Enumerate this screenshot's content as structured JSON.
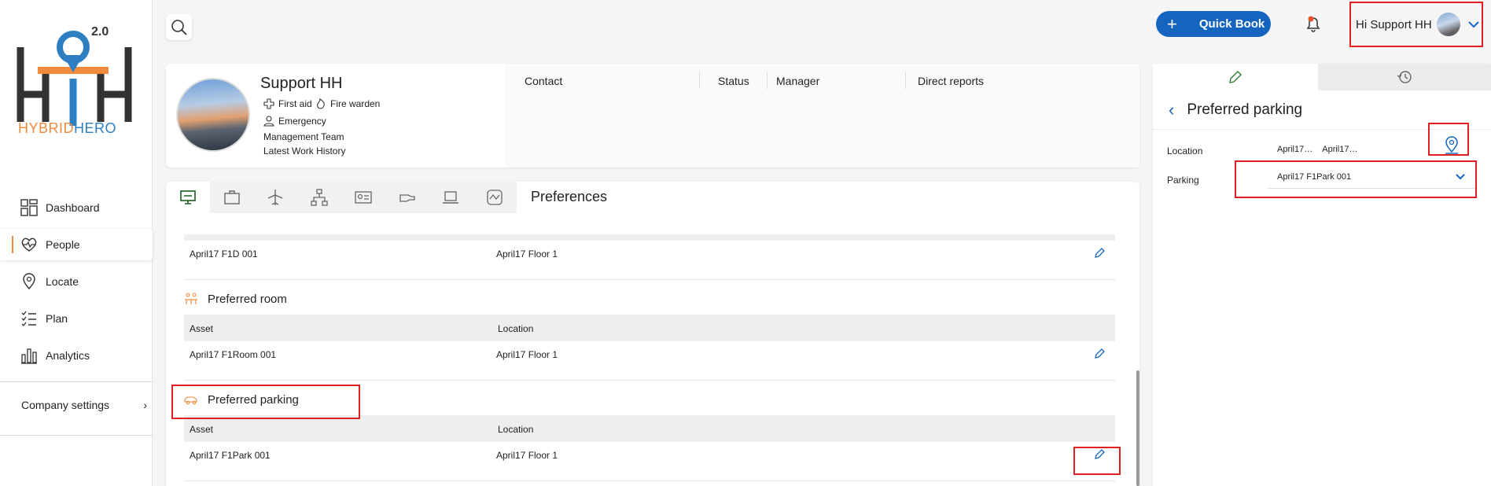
{
  "brand": {
    "version": "2.0",
    "name_part1": "HYBRID",
    "name_part2": "HERO",
    "accent_orange": "#f08a3c",
    "accent_blue": "#1565c0"
  },
  "sidebar": {
    "items": [
      {
        "label": "Dashboard",
        "icon": "dashboard-icon"
      },
      {
        "label": "People",
        "icon": "people-heart-icon"
      },
      {
        "label": "Locate",
        "icon": "location-pin-icon"
      },
      {
        "label": "Plan",
        "icon": "checklist-icon"
      },
      {
        "label": "Analytics",
        "icon": "bar-chart-icon"
      }
    ],
    "company_settings": "Company settings"
  },
  "topbar": {
    "quick_book": "Quick Book",
    "greeting": "Hi Support HH"
  },
  "profile": {
    "name": "Support HH",
    "tags": [
      "First aid",
      "Fire warden"
    ],
    "emergency": "Emergency",
    "team": "Management Team",
    "history": "Latest Work History",
    "columns": [
      "Contact",
      "Status",
      "Manager",
      "Direct reports"
    ]
  },
  "preferences": {
    "title": "Preferences",
    "desk_row": {
      "asset": "April17 F1D 001",
      "location": "April17 Floor 1"
    },
    "room": {
      "title": "Preferred room",
      "col_asset": "Asset",
      "col_location": "Location",
      "row": {
        "asset": "April17 F1Room 001",
        "location": "April17 Floor 1"
      }
    },
    "parking": {
      "title": "Preferred parking",
      "col_asset": "Asset",
      "col_location": "Location",
      "row": {
        "asset": "April17 F1Park 001",
        "location": "April17 Floor 1"
      }
    }
  },
  "panel": {
    "title": "Preferred parking",
    "location_label": "Location",
    "location_value1": "April17…",
    "location_value2": "April17…",
    "parking_label": "Parking",
    "parking_value": "April17 F1Park 001"
  }
}
